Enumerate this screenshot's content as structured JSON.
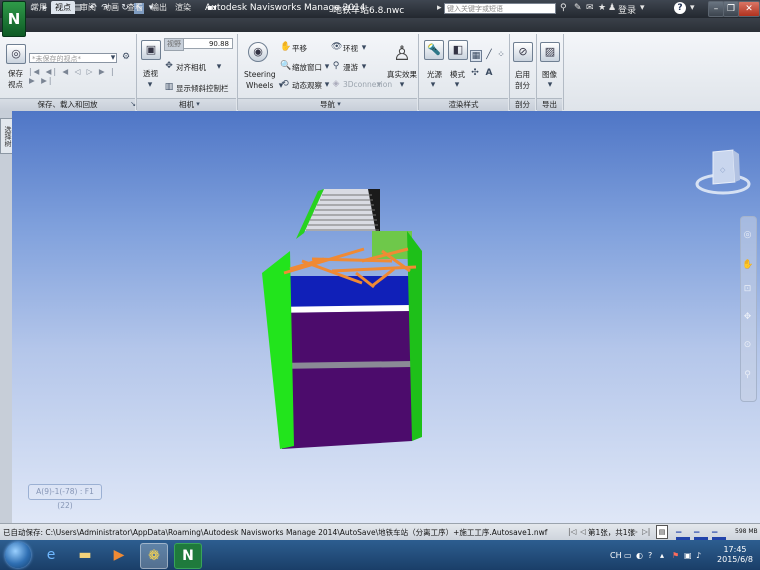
{
  "window": {
    "app_title": "Autodesk Navisworks Manage 2014",
    "doc_title": "地铁车站6.8.nwc",
    "search_placeholder": "键入关键字或短语",
    "login": "登录",
    "help": "?"
  },
  "app_button": "N",
  "tabs": [
    "常用",
    "视点",
    "审阅",
    "动画",
    "查看",
    "输出",
    "渲染"
  ],
  "active_tab_index": 1,
  "ribbon": {
    "save_view": {
      "line1": "保存",
      "line2": "视点"
    },
    "view_combo_placeholder": "*未保存的视点*",
    "playback_controls": "|◀ ◀| ◀ ◁ ▷ ▶ |▶ ▶|",
    "perspective": "透视",
    "fov_label": "视野",
    "fov_value": "90.88",
    "align_camera": "对齐相机",
    "show_tilt_bar": "显示倾斜控制栏",
    "steering_wheels": {
      "line1": "Steering",
      "line2": "Wheels"
    },
    "pan": "平移",
    "zoom_window": "缩放窗口",
    "orbit": "动态观察",
    "look_around": "环视",
    "walk": "漫游",
    "connexion": "3Dconnexion",
    "realism": "真实效果",
    "lighting": "光源",
    "mode": "模式",
    "enable_section": {
      "line1": "启用",
      "line2": "剖分"
    },
    "image": "图像",
    "panels": {
      "save_load": "保存、载入和回放",
      "camera": "相机",
      "navigate": "导航",
      "render_style": "渲染样式",
      "section": "剖分",
      "export": "导出"
    }
  },
  "side_tab": "选择树",
  "viewport": {
    "coords_readout": "A(9)-1(-78) : F1 (22)",
    "model_colors": {
      "side_green": "#22e41c",
      "top_blue": "#1020b8",
      "body_purple": "#4c0c6c",
      "members_orange": "#f08a34",
      "band_white": "#ffffff"
    }
  },
  "status": {
    "text": "已自动保存: C:\\Users\\Administrator\\AppData\\Roaming\\Autodesk Navisworks Manage 2014\\AutoSave\\地铁车站（分离工序）+施工工序.Autosave1.nwf",
    "page": "第1张，共1张",
    "memory": "598 MB"
  },
  "taskbar": {
    "time": "17:45",
    "date": "2015/6/8",
    "lang": "CH"
  }
}
